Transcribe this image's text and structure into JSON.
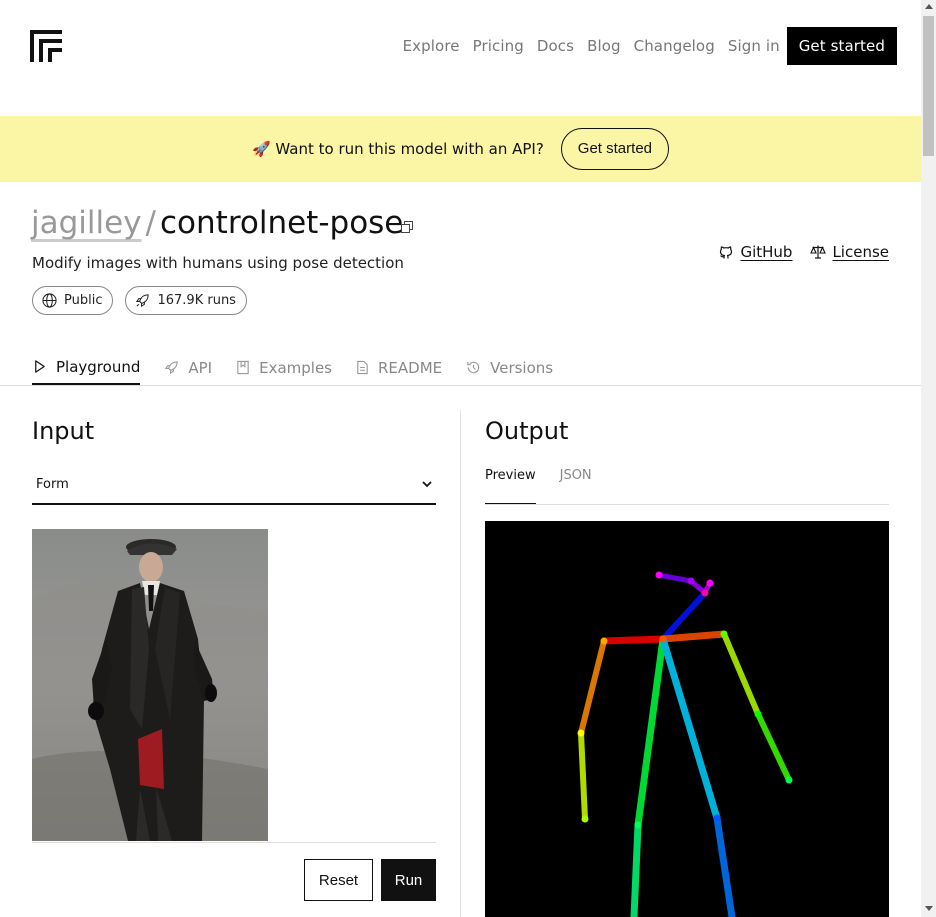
{
  "header": {
    "nav": [
      "Explore",
      "Pricing",
      "Docs",
      "Blog",
      "Changelog",
      "Sign in"
    ],
    "cta": "Get started"
  },
  "banner": {
    "text": "🚀 Want to run this model with an API?",
    "button": "Get started",
    "bg_color": "#fbf6a5"
  },
  "model": {
    "owner": "jagilley",
    "separator": "/",
    "name": "controlnet-pose",
    "description": "Modify images with humans using pose detection",
    "visibility": "Public",
    "runs": "167.9K runs",
    "github": "GitHub",
    "license": "License"
  },
  "tabs": [
    {
      "label": "Playground",
      "icon": "play-icon"
    },
    {
      "label": "API",
      "icon": "rocket-icon"
    },
    {
      "label": "Examples",
      "icon": "bookmark-icon"
    },
    {
      "label": "README",
      "icon": "document-icon"
    },
    {
      "label": "Versions",
      "icon": "history-icon"
    }
  ],
  "input": {
    "heading": "Input",
    "mode": "Form",
    "reset": "Reset",
    "run": "Run"
  },
  "output": {
    "heading": "Output",
    "tabs": [
      "Preview",
      "JSON"
    ]
  }
}
